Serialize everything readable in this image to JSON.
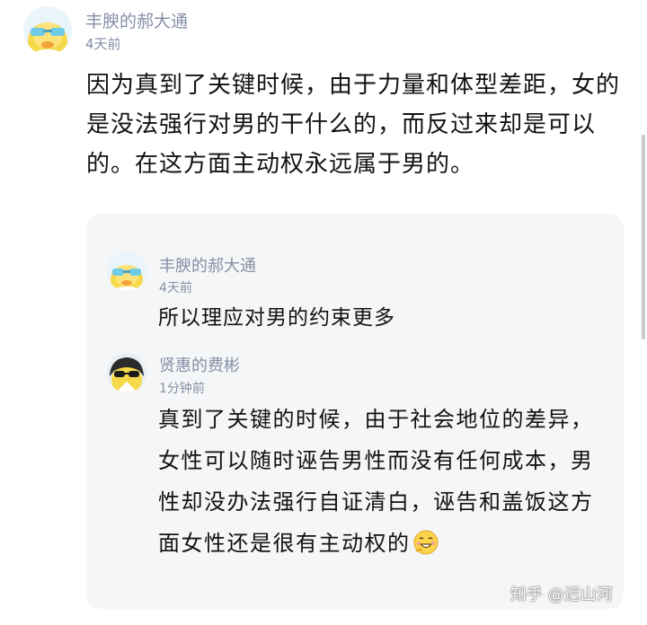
{
  "colors": {
    "meta_text": "#8590a6",
    "body_text": "#121212",
    "reply_panel_bg": "#f5f6f7"
  },
  "comment": {
    "avatar": "yellow-character-sunglasses-avatar",
    "username": "丰腴的郝大通",
    "time": "4天前",
    "content": "因为真到了关键时候，由于力量和体型差距，女的是没法强行对男的干什么的，而反过来却是可以的。在这方面主动权永远属于男的。"
  },
  "replies": [
    {
      "avatar": "yellow-character-sunglasses-avatar",
      "username": "丰腴的郝大通",
      "time": "4天前",
      "content": "所以理应对男的约束更多"
    },
    {
      "avatar": "dark-hair-sunglasses-avatar",
      "username": "贤惠的费彬",
      "time": "1分钟前",
      "content": "真到了关键的时候，由于社会地位的差异，女性可以随时诬告男性而没有任何成本，男性却没办法强行自证清白，诬告和盖饭这方面女性还是很有主动权的",
      "trailing_emoji": "sly-grin-emoji"
    }
  ],
  "watermark": "知乎 @迟山河"
}
